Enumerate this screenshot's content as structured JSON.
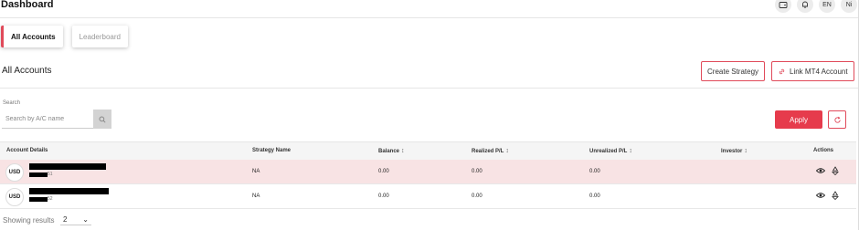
{
  "header": {
    "title": "Dashboard",
    "language": "EN",
    "user_initials": "Ni",
    "icons": [
      "wallet-icon",
      "bell-icon"
    ]
  },
  "tabs": [
    {
      "label": "All Accounts",
      "active": true
    },
    {
      "label": "Leaderboard",
      "active": false
    }
  ],
  "section": {
    "title": "All Accounts",
    "create_strategy_label": "Create Strategy",
    "link_mt4_label": "Link MT4 Account"
  },
  "search": {
    "label": "Search",
    "placeholder": "Search by A/C name",
    "value": ""
  },
  "filters": {
    "apply_label": "Apply"
  },
  "table": {
    "columns": [
      "Account Details",
      "Strategy Name",
      "Balance",
      "Realized P/L",
      "Unrealized P/L",
      "Investor",
      "Actions"
    ],
    "rows": [
      {
        "currency": "USD",
        "account_suffix": "51",
        "strategy": "NA",
        "balance": "0.00",
        "realized": "0.00",
        "unrealized": "0.00",
        "investor": ""
      },
      {
        "currency": "USD",
        "account_suffix": "52",
        "strategy": "NA",
        "balance": "0.00",
        "realized": "0.00",
        "unrealized": "0.00",
        "investor": ""
      }
    ]
  },
  "footer": {
    "showing_label": "Showing results",
    "page_size": "2"
  },
  "colors": {
    "accent": "#e63b4c",
    "highlight_row": "#f8e3e4"
  }
}
